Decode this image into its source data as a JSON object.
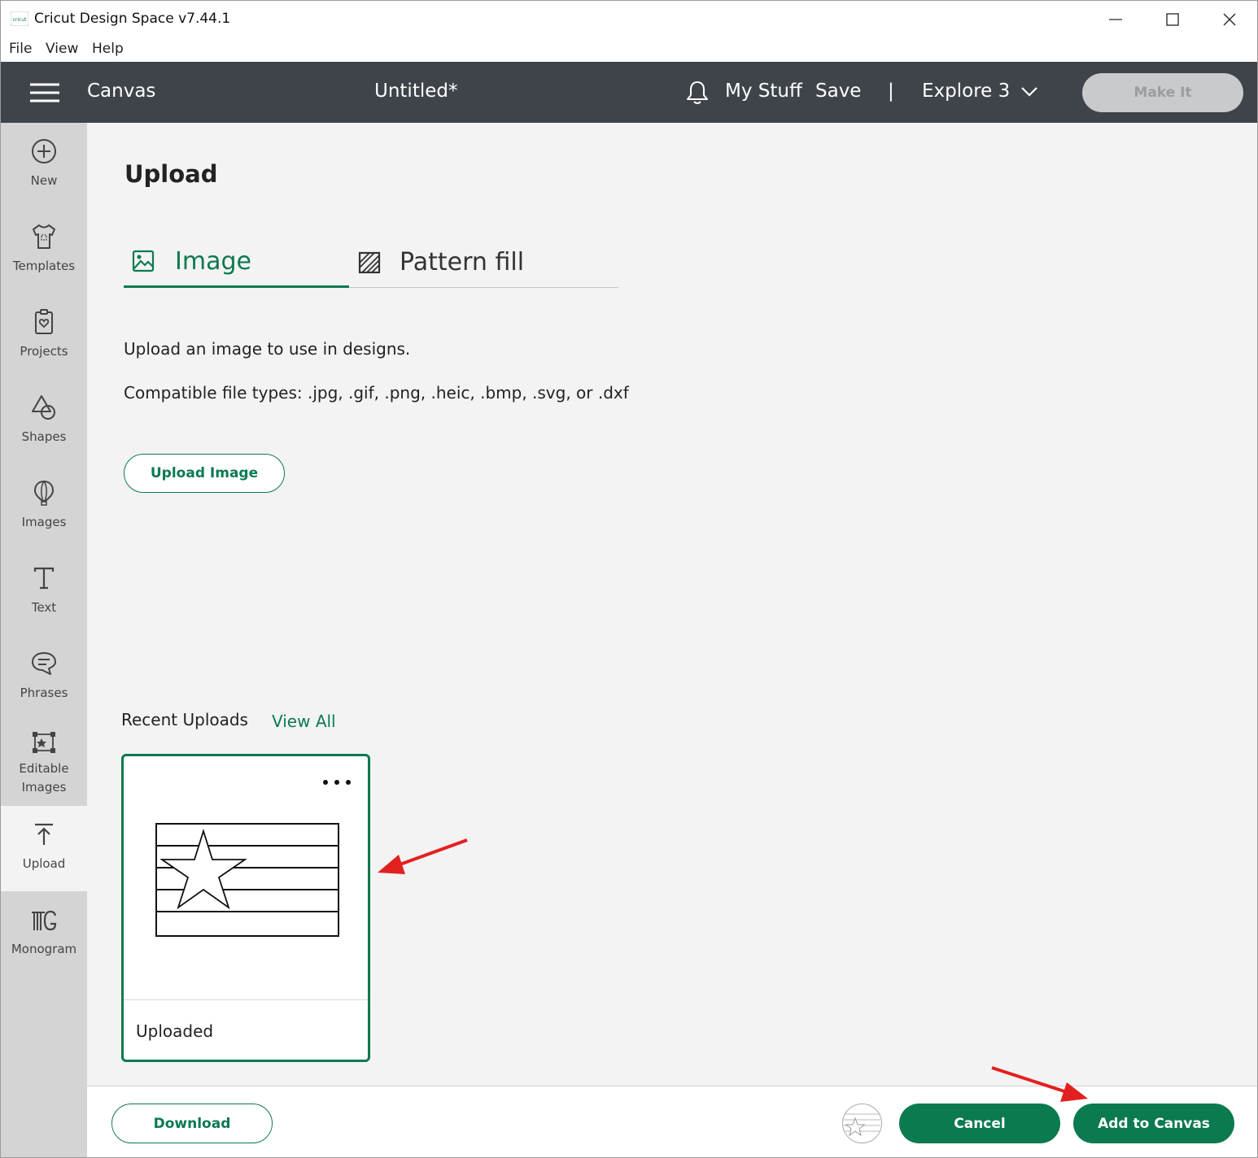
{
  "window": {
    "title": "Cricut Design Space  v7.44.1",
    "controls": [
      "minimize",
      "maximize",
      "close"
    ]
  },
  "menu": {
    "items": [
      "File",
      "View",
      "Help"
    ]
  },
  "header": {
    "section": "Canvas",
    "document_title": "Untitled*",
    "my_stuff": "My Stuff",
    "save": "Save",
    "separator": "|",
    "machine": "Explore 3",
    "make_it": "Make It"
  },
  "sidebar": {
    "items": [
      {
        "label": "New",
        "icon": "plus-circle-icon"
      },
      {
        "label": "Templates",
        "icon": "shirt-icon"
      },
      {
        "label": "Projects",
        "icon": "project-icon"
      },
      {
        "label": "Shapes",
        "icon": "shapes-icon"
      },
      {
        "label": "Images",
        "icon": "balloon-icon"
      },
      {
        "label": "Text",
        "icon": "text-icon"
      },
      {
        "label": "Phrases",
        "icon": "speech-bubble-icon"
      },
      {
        "label": "Editable\nImages",
        "label_line1": "Editable",
        "label_line2": "Images",
        "icon": "editable-images-icon"
      },
      {
        "label": "Upload",
        "icon": "upload-icon",
        "active": true
      },
      {
        "label": "Monogram",
        "icon": "monogram-icon"
      }
    ]
  },
  "upload_panel": {
    "title": "Upload",
    "tabs": [
      {
        "label": "Image",
        "icon": "image-icon",
        "active": true
      },
      {
        "label": "Pattern fill",
        "icon": "pattern-icon",
        "active": false
      }
    ],
    "description": "Upload an image to use in designs.",
    "file_types": "Compatible file types: .jpg, .gif, .png, .heic, .bmp, .svg, or .dxf",
    "upload_button": "Upload Image",
    "recent_uploads_label": "Recent Uploads",
    "view_all": "View All",
    "recent_uploads": [
      {
        "label": "Uploaded",
        "thumbnail": "star-flag-image",
        "selected": true
      }
    ]
  },
  "footer": {
    "download": "Download",
    "cancel": "Cancel",
    "add_to_canvas": "Add to Canvas"
  },
  "colors": {
    "brand_green": "#0b7a4f",
    "header_bg": "#3f444a",
    "sidebar_bg": "#d4d4d4",
    "panel_bg": "#f3f3f3",
    "annotation_red": "#e32020"
  }
}
